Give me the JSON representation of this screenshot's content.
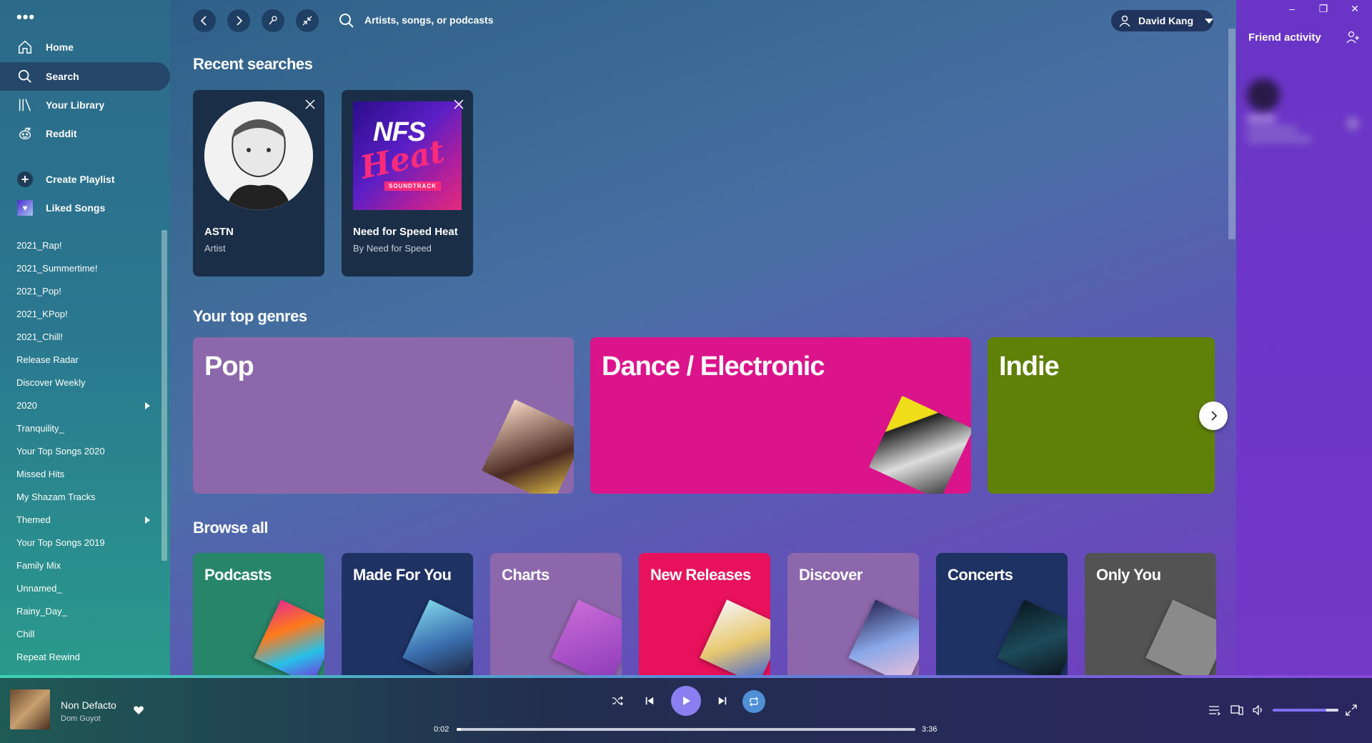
{
  "sidebar": {
    "menu_label": "•••",
    "nav": [
      {
        "label": "Home",
        "icon": "home-icon"
      },
      {
        "label": "Search",
        "icon": "search-icon"
      },
      {
        "label": "Your Library",
        "icon": "library-icon"
      },
      {
        "label": "Reddit",
        "icon": "reddit-icon"
      }
    ],
    "create_playlist": "Create Playlist",
    "liked_songs": "Liked Songs",
    "playlists": [
      "2021_Rap!",
      "2021_Summertime!",
      "2021_Pop!",
      "2021_KPop!",
      "2021_Chill!",
      "Release Radar",
      "Discover Weekly",
      "2020",
      "Tranquility_",
      "Your Top Songs 2020",
      "Missed Hits",
      "My Shazam Tracks",
      "Themed",
      "Your Top Songs 2019",
      "Family Mix",
      "Unnamed_",
      "Rainy_Day_",
      "Chill",
      "Repeat Rewind"
    ]
  },
  "topbar": {
    "search_placeholder": "Artists, songs, or podcasts",
    "user_name": "David Kang"
  },
  "recent": {
    "title": "Recent searches",
    "items": [
      {
        "title": "ASTN",
        "subtitle": "Artist"
      },
      {
        "title": "Need for Speed Heat",
        "subtitle": "By Need for Speed",
        "art_text": "NFS",
        "art_script": "Heat",
        "art_badge": "SOUNDTRACK"
      }
    ]
  },
  "genres": {
    "title": "Your top genres",
    "items": [
      {
        "label": "Pop",
        "color": "#8d67ab"
      },
      {
        "label": "Dance / Electronic",
        "color": "#dc148c"
      },
      {
        "label": "Indie",
        "color": "#608108"
      }
    ]
  },
  "browse": {
    "title": "Browse all",
    "items": [
      {
        "label": "Podcasts",
        "color": "#27856a"
      },
      {
        "label": "Made For You",
        "color": "#1e3264"
      },
      {
        "label": "Charts",
        "color": "#8d67ab"
      },
      {
        "label": "New Releases",
        "color": "#e8115b"
      },
      {
        "label": "Discover",
        "color": "#8d67ab"
      },
      {
        "label": "Concerts",
        "color": "#1e3264"
      },
      {
        "label": "Only You",
        "color": "#535353"
      }
    ]
  },
  "friend_activity": {
    "title": "Friend activity"
  },
  "player": {
    "track": "Non Defacto",
    "artist": "Dom Guyot",
    "elapsed": "0:02",
    "duration": "3:36",
    "progress": 0.01,
    "volume": 0.82
  },
  "window": {
    "minimize": "–",
    "restore": "❐",
    "close": "✕"
  }
}
